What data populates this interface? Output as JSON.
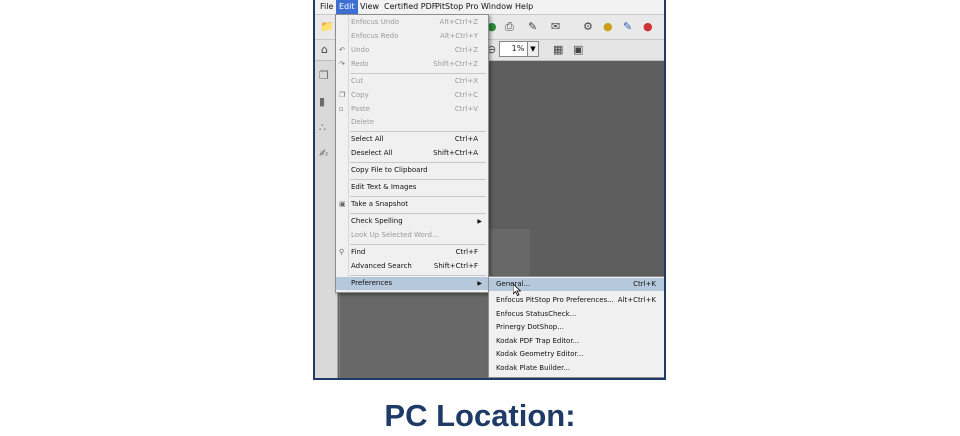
{
  "menubar": {
    "items": [
      "File",
      "Edit",
      "View",
      "Certified PDF",
      "PitStop Pro",
      "Window",
      "Help"
    ],
    "active": "Edit"
  },
  "zoom": "1%",
  "edit_menu": {
    "items": [
      {
        "label": "Enfocus Undo",
        "shortcut": "Alt+Ctrl+Z",
        "disabled": true
      },
      {
        "label": "Enfocus Redo",
        "shortcut": "Alt+Ctrl+Y",
        "disabled": true
      },
      {
        "label": "Undo",
        "shortcut": "Ctrl+Z",
        "disabled": true
      },
      {
        "label": "Redo",
        "shortcut": "Shift+Ctrl+Z",
        "disabled": true
      },
      {
        "label": "Cut",
        "shortcut": "Ctrl+X",
        "disabled": true
      },
      {
        "label": "Copy",
        "shortcut": "Ctrl+C",
        "disabled": true
      },
      {
        "label": "Paste",
        "shortcut": "Ctrl+V",
        "disabled": true
      },
      {
        "label": "Delete",
        "shortcut": "",
        "disabled": true
      },
      {
        "label": "Select All",
        "shortcut": "Ctrl+A",
        "disabled": false
      },
      {
        "label": "Deselect All",
        "shortcut": "Shift+Ctrl+A",
        "disabled": false
      },
      {
        "label": "Copy File to Clipboard",
        "shortcut": "",
        "disabled": false
      },
      {
        "label": "Edit Text & Images",
        "shortcut": "",
        "disabled": false
      },
      {
        "label": "Take a Snapshot",
        "shortcut": "",
        "disabled": false
      },
      {
        "label": "Check Spelling",
        "shortcut": "",
        "disabled": false
      },
      {
        "label": "Look Up Selected Word...",
        "shortcut": "",
        "disabled": true
      },
      {
        "label": "Find",
        "shortcut": "Ctrl+F",
        "disabled": false
      },
      {
        "label": "Advanced Search",
        "shortcut": "Shift+Ctrl+F",
        "disabled": false
      },
      {
        "label": "Preferences",
        "shortcut": "",
        "disabled": false
      }
    ]
  },
  "preferences_submenu": {
    "items": [
      {
        "label": "General...",
        "shortcut": "Ctrl+K"
      },
      {
        "label": "Enfocus PitStop Pro Preferences...",
        "shortcut": "Alt+Ctrl+K"
      },
      {
        "label": "Enfocus StatusCheck...",
        "shortcut": ""
      },
      {
        "label": "Prinergy DotShop...",
        "shortcut": ""
      },
      {
        "label": "Kodak PDF Trap Editor...",
        "shortcut": ""
      },
      {
        "label": "Kodak Geometry Editor...",
        "shortcut": ""
      },
      {
        "label": "Kodak Plate Builder...",
        "shortcut": ""
      }
    ]
  },
  "caption": "PC Location:",
  "colors": {
    "accent": "#3c6fd1",
    "caption": "#1f3a66",
    "highlight": "#b6c8dc"
  }
}
